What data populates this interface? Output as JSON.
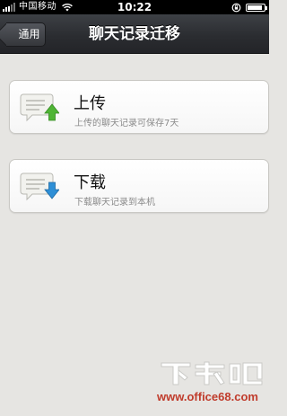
{
  "status_bar": {
    "carrier": "中国移动",
    "time": "10:22",
    "battery_level": 0.9,
    "signal_bars": 3
  },
  "nav": {
    "back_label": "通用",
    "title": "聊天记录迁移"
  },
  "options": [
    {
      "title": "上传",
      "subtitle": "上传的聊天记录可保存7天",
      "icon": "chat-upload-icon",
      "arrow_color": "#4fb535"
    },
    {
      "title": "下载",
      "subtitle": "下载聊天记录到本机",
      "icon": "chat-download-icon",
      "arrow_color": "#2e8fd6"
    }
  ],
  "watermark": {
    "logo": "下载吧",
    "url": "www.office68.com"
  },
  "colors": {
    "background": "#e6e5e2",
    "nav_bar": "#2b2d31",
    "card": "#ffffff",
    "watermark_red": "#c03c2c"
  }
}
